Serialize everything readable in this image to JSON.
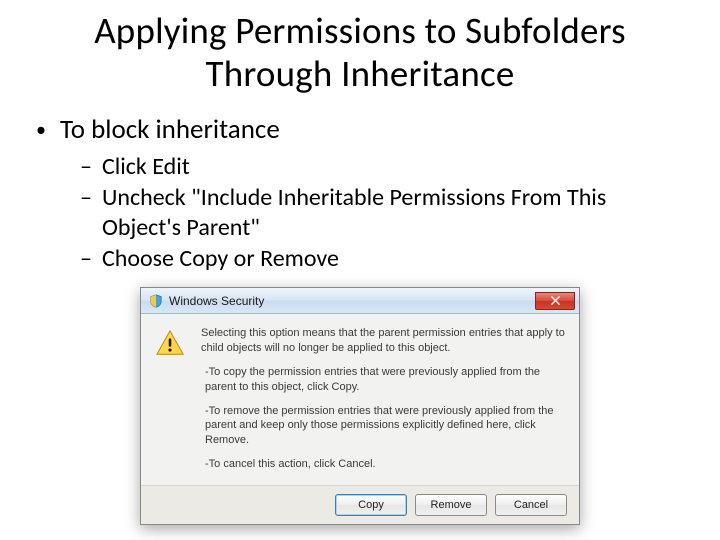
{
  "slide": {
    "title": "Applying Permissions to Subfolders Through Inheritance",
    "bullet_lvl1": "To block inheritance",
    "bullets_lvl2": {
      "b0": "Click Edit",
      "b1": "Uncheck \"Include Inheritable Permissions From This Object's Parent\"",
      "b2": "Choose Copy or Remove"
    }
  },
  "dialog": {
    "title": "Windows Security",
    "intro": "Selecting this option means that the parent permission entries that apply to child objects will no longer be applied to this object.",
    "opt_copy": "-To copy the permission entries that were previously applied from the parent to this object, click Copy.",
    "opt_remove": "-To remove the permission entries that were previously applied from the parent and keep only those permissions explicitly defined here, click Remove.",
    "opt_cancel": "-To cancel this action, click Cancel.",
    "buttons": {
      "copy": "Copy",
      "remove": "Remove",
      "cancel": "Cancel"
    }
  }
}
